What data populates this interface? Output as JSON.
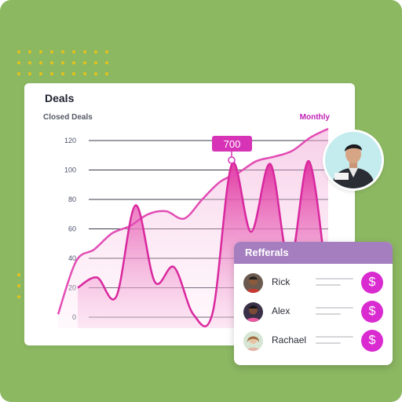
{
  "card": {
    "title": "Deals",
    "subtitle": "Closed Deals",
    "period": "Monthly"
  },
  "chart_data": {
    "type": "area",
    "ylim": [
      0,
      120
    ],
    "yticks": [
      "120",
      "100",
      "80",
      "60",
      "40",
      "20",
      "0"
    ],
    "series": [
      {
        "values": [
          2,
          38,
          46,
          57,
          62,
          70,
          72,
          67,
          80,
          92,
          98,
          106,
          109,
          113,
          122,
          128
        ]
      },
      {
        "values": [
          20,
          27,
          14,
          76,
          24,
          34,
          2,
          3,
          104,
          58,
          104,
          36,
          106,
          15
        ]
      }
    ],
    "tooltip": {
      "label": "700"
    },
    "colors": {
      "accent": "#c021b5",
      "line": "#e24cb4",
      "gridline": "#3a3c4a"
    }
  },
  "referrals": {
    "title": "Refferals",
    "items": [
      {
        "name": "Rick",
        "icon": "dollar-icon",
        "symbol": "$"
      },
      {
        "name": "Alex",
        "icon": "dollar-icon",
        "symbol": "$"
      },
      {
        "name": "Rachael",
        "icon": "dollar-icon",
        "symbol": "$"
      }
    ]
  }
}
